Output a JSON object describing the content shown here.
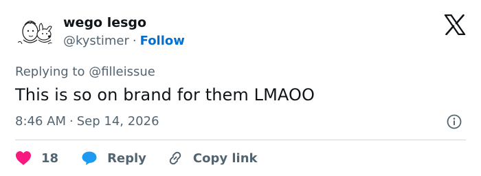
{
  "author": {
    "display_name": "wego lesgo",
    "handle": "@kystimer",
    "separator": "·",
    "follow_label": "Follow",
    "avatar": "cartoon-boy-and-dog-avatar"
  },
  "reply_context": {
    "prefix": "Replying to",
    "mention": "@filleissue"
  },
  "tweet": {
    "text": "This is so on brand for them LMAOO",
    "time": "8:46 AM",
    "separator": "·",
    "date": "Sep 14, 2026"
  },
  "actions": {
    "like_count": "18",
    "reply_label": "Reply",
    "copy_link_label": "Copy link"
  },
  "icons": {
    "brand": "x-logo-icon",
    "info": "info-icon",
    "like": "heart-icon",
    "reply": "speech-bubble-icon",
    "link": "link-icon"
  },
  "colors": {
    "text_primary": "#0f1419",
    "text_secondary": "#536471",
    "follow_blue": "#006fd6",
    "heart_pink": "#f91880",
    "reply_blue": "#1d9bf0",
    "divider": "#cfd9de"
  }
}
